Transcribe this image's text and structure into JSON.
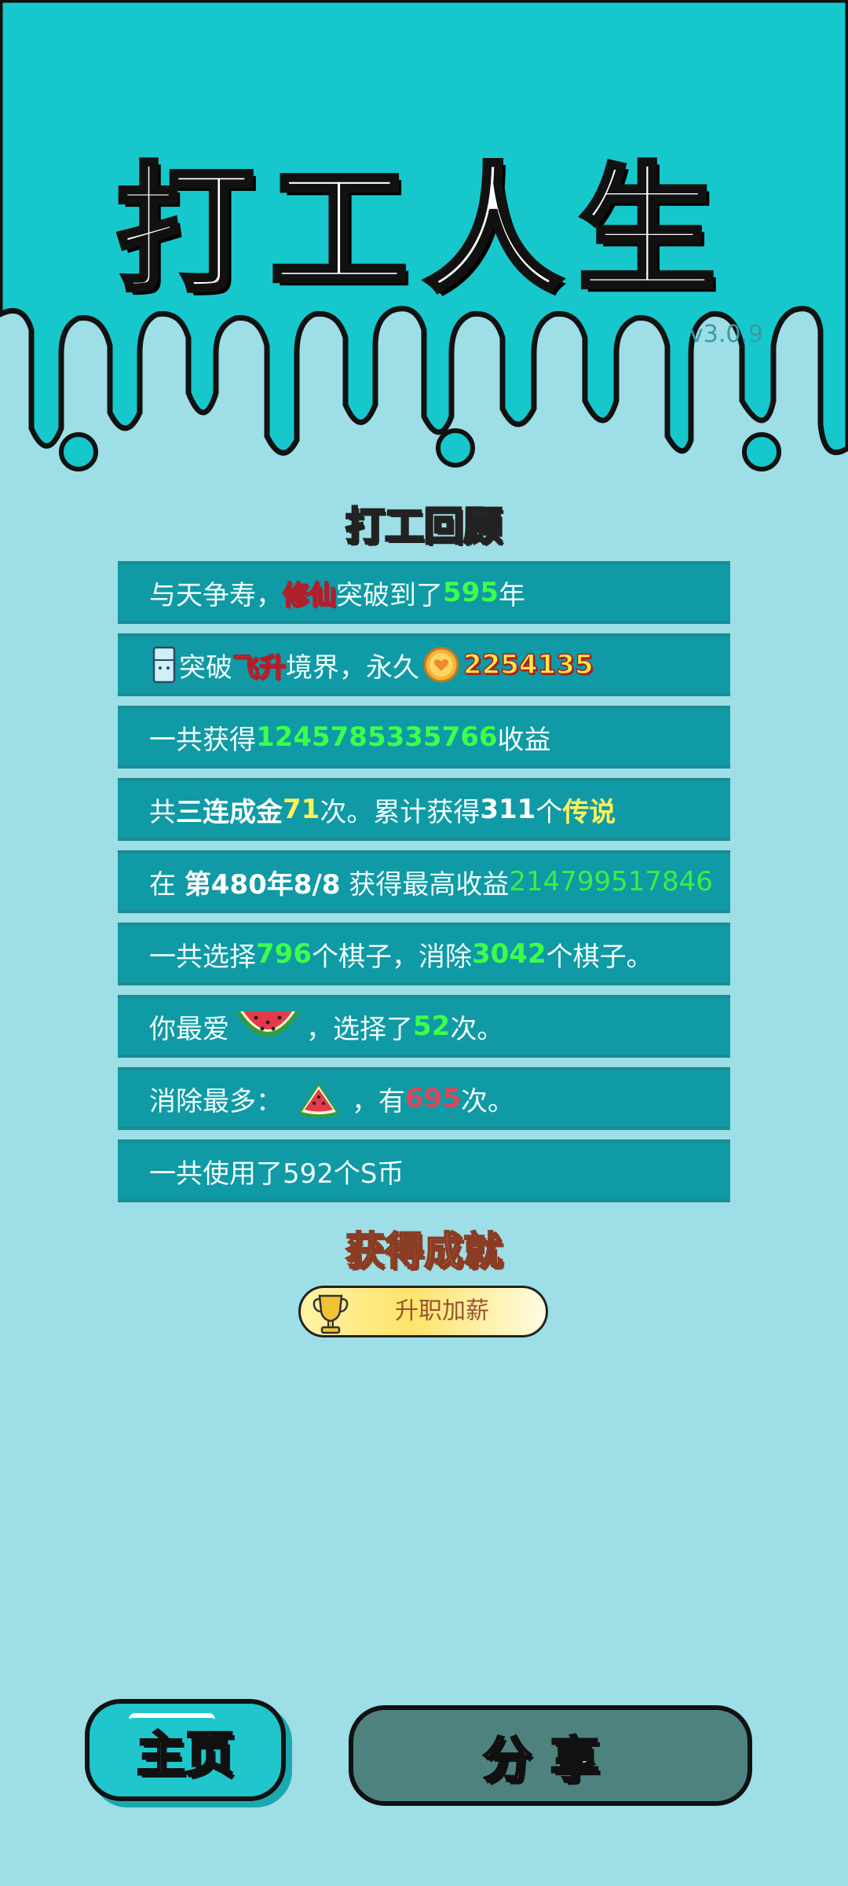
{
  "header": {
    "game_title": "打工人生",
    "version": "v3.0.9"
  },
  "review": {
    "title": "打工回顾",
    "rows": [
      {
        "parts": [
          "与天争寿，",
          "修仙",
          "突破到了",
          "595",
          "年"
        ]
      },
      {
        "parts": [
          "突破",
          "飞升",
          "境界，永久",
          "2254135"
        ]
      },
      {
        "parts": [
          "一共获得",
          "1245785335766",
          "收益"
        ]
      },
      {
        "parts": [
          "共",
          "三连成金",
          "71",
          "次。累计获得",
          "311",
          "个",
          "传说"
        ]
      },
      {
        "parts": [
          "在 ",
          "第480年8/8",
          " 获得最高收益",
          "214799517846"
        ]
      },
      {
        "parts": [
          "一共选择",
          "796",
          "个棋子，消除",
          "3042",
          "个棋子。"
        ]
      },
      {
        "parts": [
          "你最爱",
          "，选择了",
          "52",
          "次。"
        ]
      },
      {
        "parts": [
          "消除最多：",
          "，有",
          "695",
          "次。"
        ]
      },
      {
        "parts": [
          "一共使用了592个S币"
        ]
      }
    ]
  },
  "icons": {
    "fridge": "fridge-icon",
    "coin": "heart-coin-icon",
    "watermelon": "watermelon-icon",
    "watermelon_slice": "watermelon-slice-icon",
    "trophy": "trophy-icon"
  },
  "achievements": {
    "title": "获得成就",
    "badge_label": "升职加薪"
  },
  "buttons": {
    "home": "主页",
    "share": "分享"
  },
  "colors": {
    "top_bg": "#16c8cc",
    "page_bg": "#9edee6",
    "row_bg": "#0f9aa5",
    "share_btn": "#4d827f"
  }
}
